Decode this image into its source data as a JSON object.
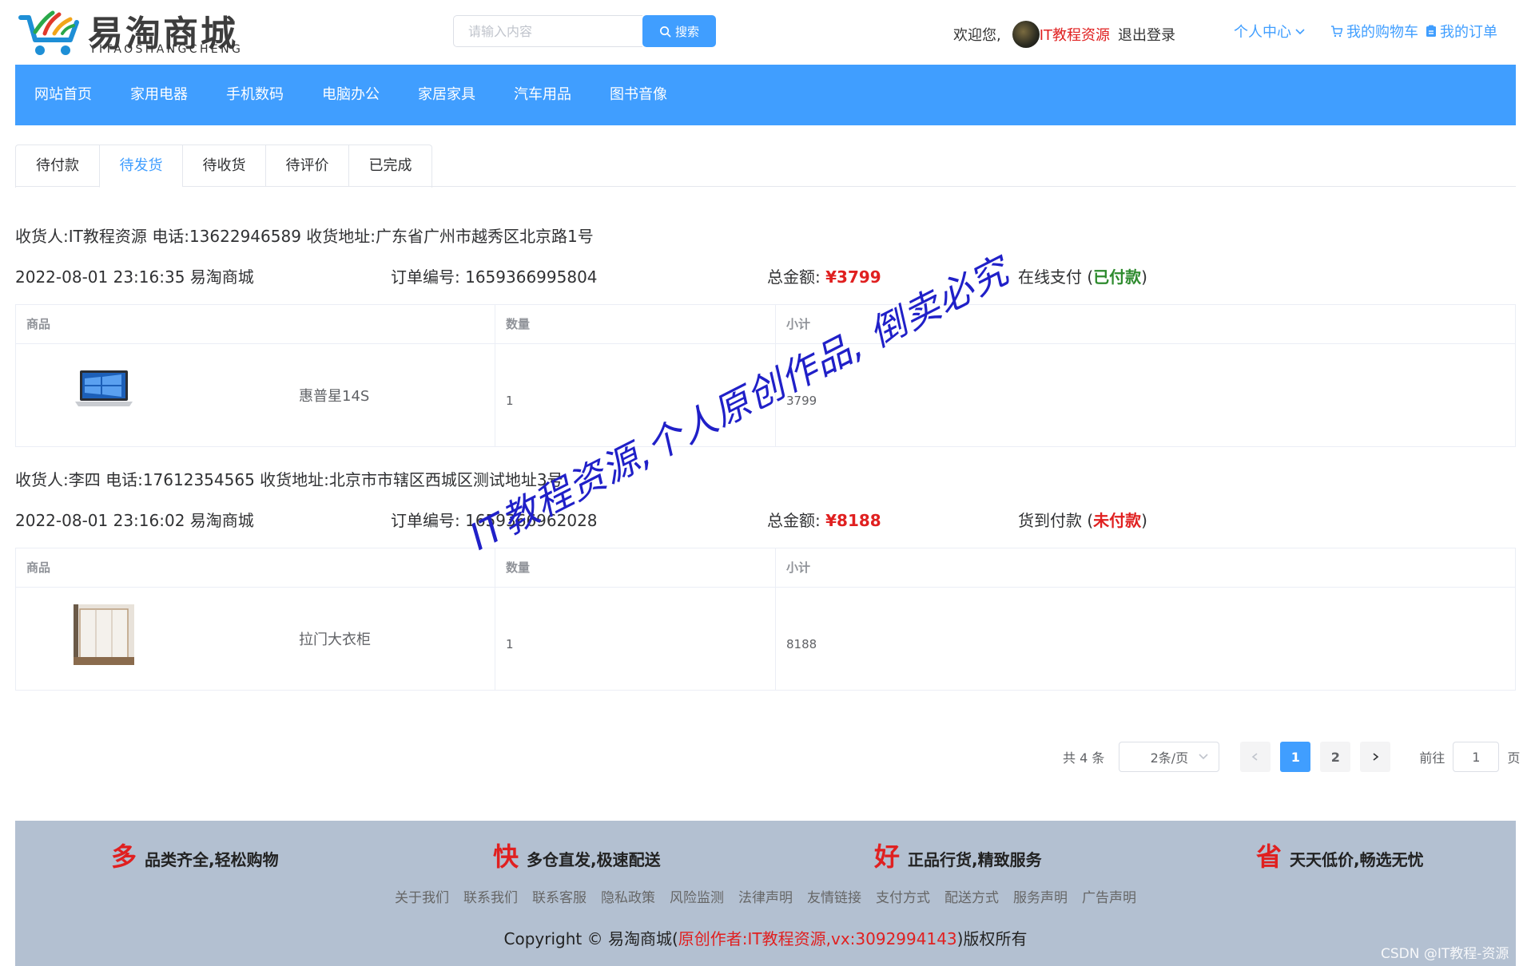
{
  "header": {
    "logo_cn": "易淘商城",
    "logo_en": "YITAOSHANGCHENG",
    "search_placeholder": "请输入内容",
    "search_label": "搜索",
    "welcome": "欢迎您,",
    "username": "IT教程资源",
    "logout": "退出登录",
    "user_center": "个人中心",
    "cart": "我的购物车",
    "orders": "我的订单",
    "accent_color": "#409eff"
  },
  "nav": {
    "items": [
      "网站首页",
      "家用电器",
      "手机数码",
      "电脑办公",
      "家居家具",
      "汽车用品",
      "图书音像"
    ]
  },
  "tabs": {
    "items": [
      "待付款",
      "待发货",
      "待收货",
      "待评价",
      "已完成"
    ],
    "active": "待发货"
  },
  "orders": [
    {
      "address_line": "收货人:IT教程资源  电话:13622946589  收货地址:广东省广州市越秀区北京路1号",
      "datetime_store": "2022-08-01 23:16:35  易淘商城",
      "order_no": "订单编号:  1659366995804",
      "total_label": "总金额:",
      "total": "¥3799",
      "pay_method": "在线支付 (",
      "pay_status": "已付款",
      "pay_close": ")",
      "headers": [
        "商品",
        "数量",
        "小计"
      ],
      "item": {
        "name": "惠普星14S",
        "qty": "1",
        "subtotal": "3799",
        "image": "laptop"
      }
    },
    {
      "address_line": "收货人:李四  电话:17612354565  收货地址:北京市市辖区西城区测试地址3号",
      "datetime_store": "2022-08-01 23:16:02  易淘商城",
      "order_no": "订单编号:  1659366962028",
      "total_label": "总金额:",
      "total": "¥8188",
      "pay_method": "货到付款 (",
      "pay_status": "未付款",
      "pay_close": ")",
      "headers": [
        "商品",
        "数量",
        "小计"
      ],
      "item": {
        "name": "拉门大衣柜",
        "qty": "1",
        "subtotal": "8188",
        "image": "wardrobe"
      }
    }
  ],
  "watermark": "IT教程资源,个人原创作品, 倒卖必究",
  "pagination": {
    "total": "共 4 条",
    "page_size": "2条/页",
    "pages": [
      "1",
      "2"
    ],
    "current": "1",
    "goto_prefix": "前往",
    "goto_value": "1",
    "goto_suffix": "页"
  },
  "footer": {
    "promises": [
      {
        "big": "多",
        "text": "品类齐全,轻松购物"
      },
      {
        "big": "快",
        "text": "多仓直发,极速配送"
      },
      {
        "big": "好",
        "text": "正品行货,精致服务"
      },
      {
        "big": "省",
        "text": "天天低价,畅选无忧"
      }
    ],
    "links": [
      "关于我们",
      "联系我们",
      "联系客服",
      "隐私政策",
      "风险监测",
      "法律声明",
      "友情链接",
      "支付方式",
      "配送方式",
      "服务声明",
      "广告声明"
    ],
    "copyright_pre": "Copyright © 易淘商城(",
    "copyright_red": "原创作者:IT教程资源,vx:3092994143",
    "copyright_post": ")版权所有",
    "bg_color": "#b3c0d1"
  },
  "csdn_mark": "CSDN @IT教程-资源"
}
